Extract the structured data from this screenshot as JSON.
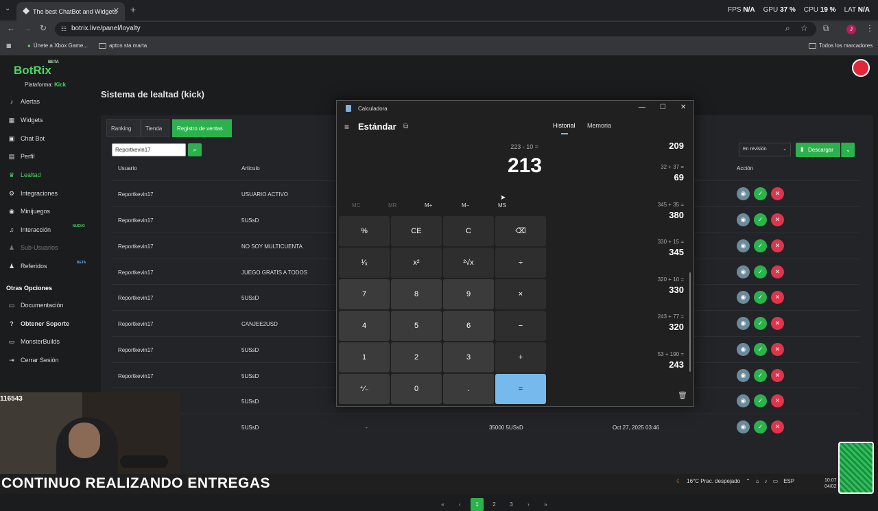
{
  "browser": {
    "tab_title": "The best ChatBot and Widgets",
    "url": "botrix.live/panel/loyalty",
    "perf": {
      "fps_label": "FPS",
      "fps_value": "N/A",
      "gpu_label": "GPU",
      "gpu_value": "37 %",
      "cpu_label": "CPU",
      "cpu_value": "19 %",
      "lat_label": "LAT",
      "lat_value": "N/A"
    },
    "avatar_letter": "J",
    "bookmarks": [
      "Únete a Xbox Game...",
      "aptos sta marta"
    ],
    "all_bookmarks": "Todos los marcadores"
  },
  "app": {
    "logo": "BotRix",
    "beta": "BETA",
    "platform_label": "Plataforma:",
    "platform_value": "Kick",
    "nav": [
      {
        "label": "Alertas",
        "icon": "bell-icon"
      },
      {
        "label": "Widgets",
        "icon": "widgets-icon"
      },
      {
        "label": "Chat Bot",
        "icon": "chat-icon"
      },
      {
        "label": "Perfil",
        "icon": "user-icon"
      },
      {
        "label": "Lealtad",
        "icon": "trophy-icon"
      },
      {
        "label": "Integraciones",
        "icon": "gear-icon"
      },
      {
        "label": "Minijuegos",
        "icon": "gamepad-icon"
      },
      {
        "label": "Interacción",
        "icon": "music-icon",
        "badge": "NUEVO"
      },
      {
        "label": "Sub-Usuarios",
        "icon": "users-icon"
      },
      {
        "label": "Referidos",
        "icon": "group-icon",
        "badge": "BETA"
      }
    ],
    "other_title": "Otras Opciones",
    "other": [
      {
        "label": "Documentación",
        "icon": "doc-icon"
      },
      {
        "label": "Obtener Soporte",
        "icon": "help-icon"
      },
      {
        "label": "MonsterBuilds",
        "icon": "monitor-icon"
      },
      {
        "label": "Cerrar Sesión",
        "icon": "logout-icon"
      }
    ],
    "page_title": "Sistema de lealtad (kick)",
    "tabs": [
      "Ranking",
      "Tienda",
      "Registro de ventas"
    ],
    "search_value": "Reportkevin17",
    "filter_value": "En revisión",
    "download_label": "Descargar",
    "columns": {
      "user": "Usuario",
      "article": "Articulo",
      "action": "Acción"
    },
    "rows": [
      {
        "user": "Reportkevin17",
        "article": "USUARIO ACTIVO"
      },
      {
        "user": "Reportkevin17",
        "article": "5USsD"
      },
      {
        "user": "Reportkevin17",
        "article": "NO SOY MULTICUENTA"
      },
      {
        "user": "Reportkevin17",
        "article": "JUEGO GRATIS A TODOS"
      },
      {
        "user": "Reportkevin17",
        "article": "5USsD"
      },
      {
        "user": "Reportkevin17",
        "article": "CANJEE2USD"
      },
      {
        "user": "Reportkevin17",
        "article": "5USsD"
      },
      {
        "user": "Reportkevin17",
        "article": "5USsD"
      },
      {
        "user": "",
        "article": "5USsD"
      },
      {
        "user": "",
        "article": "5USsD",
        "dash": "-",
        "amount": "35000 5USsD",
        "date": "Oct 27, 2025 03:46"
      }
    ],
    "pages": [
      "1",
      "2",
      "3"
    ]
  },
  "calculator": {
    "title": "Calculadora",
    "mode": "Estándar",
    "expression": "223 - 10 =",
    "result": "213",
    "memory": [
      "MC",
      "MR",
      "M+",
      "M−",
      "MS"
    ],
    "keys": [
      "%",
      "CE",
      "C",
      "⌫",
      "¹⁄ₓ",
      "x²",
      "²√x",
      "÷",
      "7",
      "8",
      "9",
      "×",
      "4",
      "5",
      "6",
      "−",
      "1",
      "2",
      "3",
      "+",
      "⁺⁄₋",
      "0",
      ".",
      "="
    ],
    "history_tab": "Historial",
    "memory_tab": "Memoria",
    "history": [
      {
        "expr": "",
        "result": "209"
      },
      {
        "expr": "32  +  37 =",
        "result": "69"
      },
      {
        "expr": "345  +  35 =",
        "result": "380"
      },
      {
        "expr": "330  +  15 =",
        "result": "345"
      },
      {
        "expr": "320  +  10 =",
        "result": "330"
      },
      {
        "expr": "243  +  77 =",
        "result": "320"
      },
      {
        "expr": "53  +  190 =",
        "result": "243"
      }
    ]
  },
  "overlay": {
    "handle": "116543",
    "banner": "CONTINUO REALIZANDO ENTREGAS",
    "weather": "16°C  Prac. despejado",
    "lang": "ESP",
    "time": "10:07",
    "date": "04/02"
  }
}
